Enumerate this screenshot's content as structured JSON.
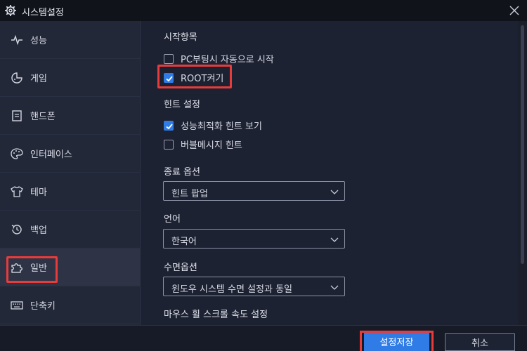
{
  "window": {
    "title": "시스템설정"
  },
  "sidebar": {
    "items": [
      {
        "label": "성능",
        "icon": "pulse-icon"
      },
      {
        "label": "게임",
        "icon": "gamepad-icon"
      },
      {
        "label": "핸드폰",
        "icon": "phone-icon"
      },
      {
        "label": "인터페이스",
        "icon": "palette-icon"
      },
      {
        "label": "테마",
        "icon": "shirt-icon"
      },
      {
        "label": "백업",
        "icon": "backup-icon"
      },
      {
        "label": "일반",
        "icon": "puzzle-icon",
        "selected": true
      },
      {
        "label": "단축키",
        "icon": "keyboard-icon"
      }
    ]
  },
  "content": {
    "startup": {
      "title": "시작항목",
      "pc_boot": {
        "label": "PC부팅시 자동으로 시작",
        "checked": false
      },
      "root": {
        "label": "ROOT켜기",
        "checked": true
      }
    },
    "hints": {
      "title": "힌트 설정",
      "perf_hint": {
        "label": "성능최적화 힌트 보기",
        "checked": true
      },
      "bubble_hint": {
        "label": "버블메시지 힌트",
        "checked": false
      }
    },
    "exit_option": {
      "title": "종료 옵션",
      "value": "힌트 팝업"
    },
    "language": {
      "title": "언어",
      "value": "한국어"
    },
    "sleep_option": {
      "title": "수면옵션",
      "value": "윈도우 시스템 수면 설정과 동일"
    },
    "mouse_wheel": {
      "title": "마우스 휠 스크롤 속도 설정"
    }
  },
  "footer": {
    "save_label": "설정저장",
    "cancel_label": "취소"
  },
  "colors": {
    "accent": "#2f7ce6",
    "highlight": "#e83b3b",
    "sidebar_bg": "#232838",
    "content_bg": "#1d2232"
  }
}
